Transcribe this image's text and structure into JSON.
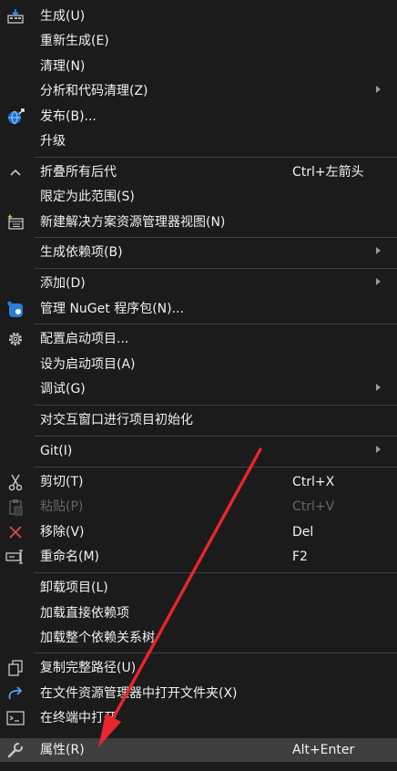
{
  "menu": {
    "items": [
      {
        "label": "生成(U)",
        "icon": "build-icon"
      },
      {
        "label": "重新生成(E)"
      },
      {
        "label": "清理(N)"
      },
      {
        "label": "分析和代码清理(Z)",
        "submenu": true
      },
      {
        "label": "发布(B)...",
        "icon": "globe-publish-icon"
      },
      {
        "label": "升级"
      },
      {
        "label": "折叠所有后代",
        "shortcut": "Ctrl+左箭头",
        "icon": "chevron-up-icon"
      },
      {
        "label": "限定为此范围(S)"
      },
      {
        "label": "新建解决方案资源管理器视图(N)",
        "icon": "new-view-icon"
      },
      {
        "label": "生成依赖项(B)",
        "submenu": true
      },
      {
        "label": "添加(D)",
        "submenu": true
      },
      {
        "label": "管理 NuGet 程序包(N)...",
        "icon": "nuget-icon"
      },
      {
        "label": "配置启动项目...",
        "icon": "gear-icon"
      },
      {
        "label": "设为启动项目(A)"
      },
      {
        "label": "调试(G)",
        "submenu": true
      },
      {
        "label": "对交互窗口进行项目初始化"
      },
      {
        "label": "Git(I)",
        "submenu": true
      },
      {
        "label": "剪切(T)",
        "shortcut": "Ctrl+X",
        "icon": "scissors-icon"
      },
      {
        "label": "粘贴(P)",
        "shortcut": "Ctrl+V",
        "icon": "clipboard-icon",
        "disabled": true
      },
      {
        "label": "移除(V)",
        "shortcut": "Del",
        "icon": "close-red-icon"
      },
      {
        "label": "重命名(M)",
        "shortcut": "F2",
        "icon": "rename-icon"
      },
      {
        "label": "卸载项目(L)"
      },
      {
        "label": "加载直接依赖项"
      },
      {
        "label": "加载整个依赖关系树"
      },
      {
        "label": "复制完整路径(U)",
        "icon": "copy-icon"
      },
      {
        "label": "在文件资源管理器中打开文件夹(X)",
        "icon": "redo-arrow-icon"
      },
      {
        "label": "在终端中打开",
        "icon": "terminal-icon"
      },
      {
        "label": "属性(R)",
        "shortcut": "Alt+Enter",
        "icon": "wrench-icon",
        "hovered": true
      }
    ]
  },
  "colors": {
    "background": "#1b1b1c",
    "hover": "#3e3e40",
    "separator": "#3f3f46",
    "annotation_arrow": "#e8262b"
  }
}
